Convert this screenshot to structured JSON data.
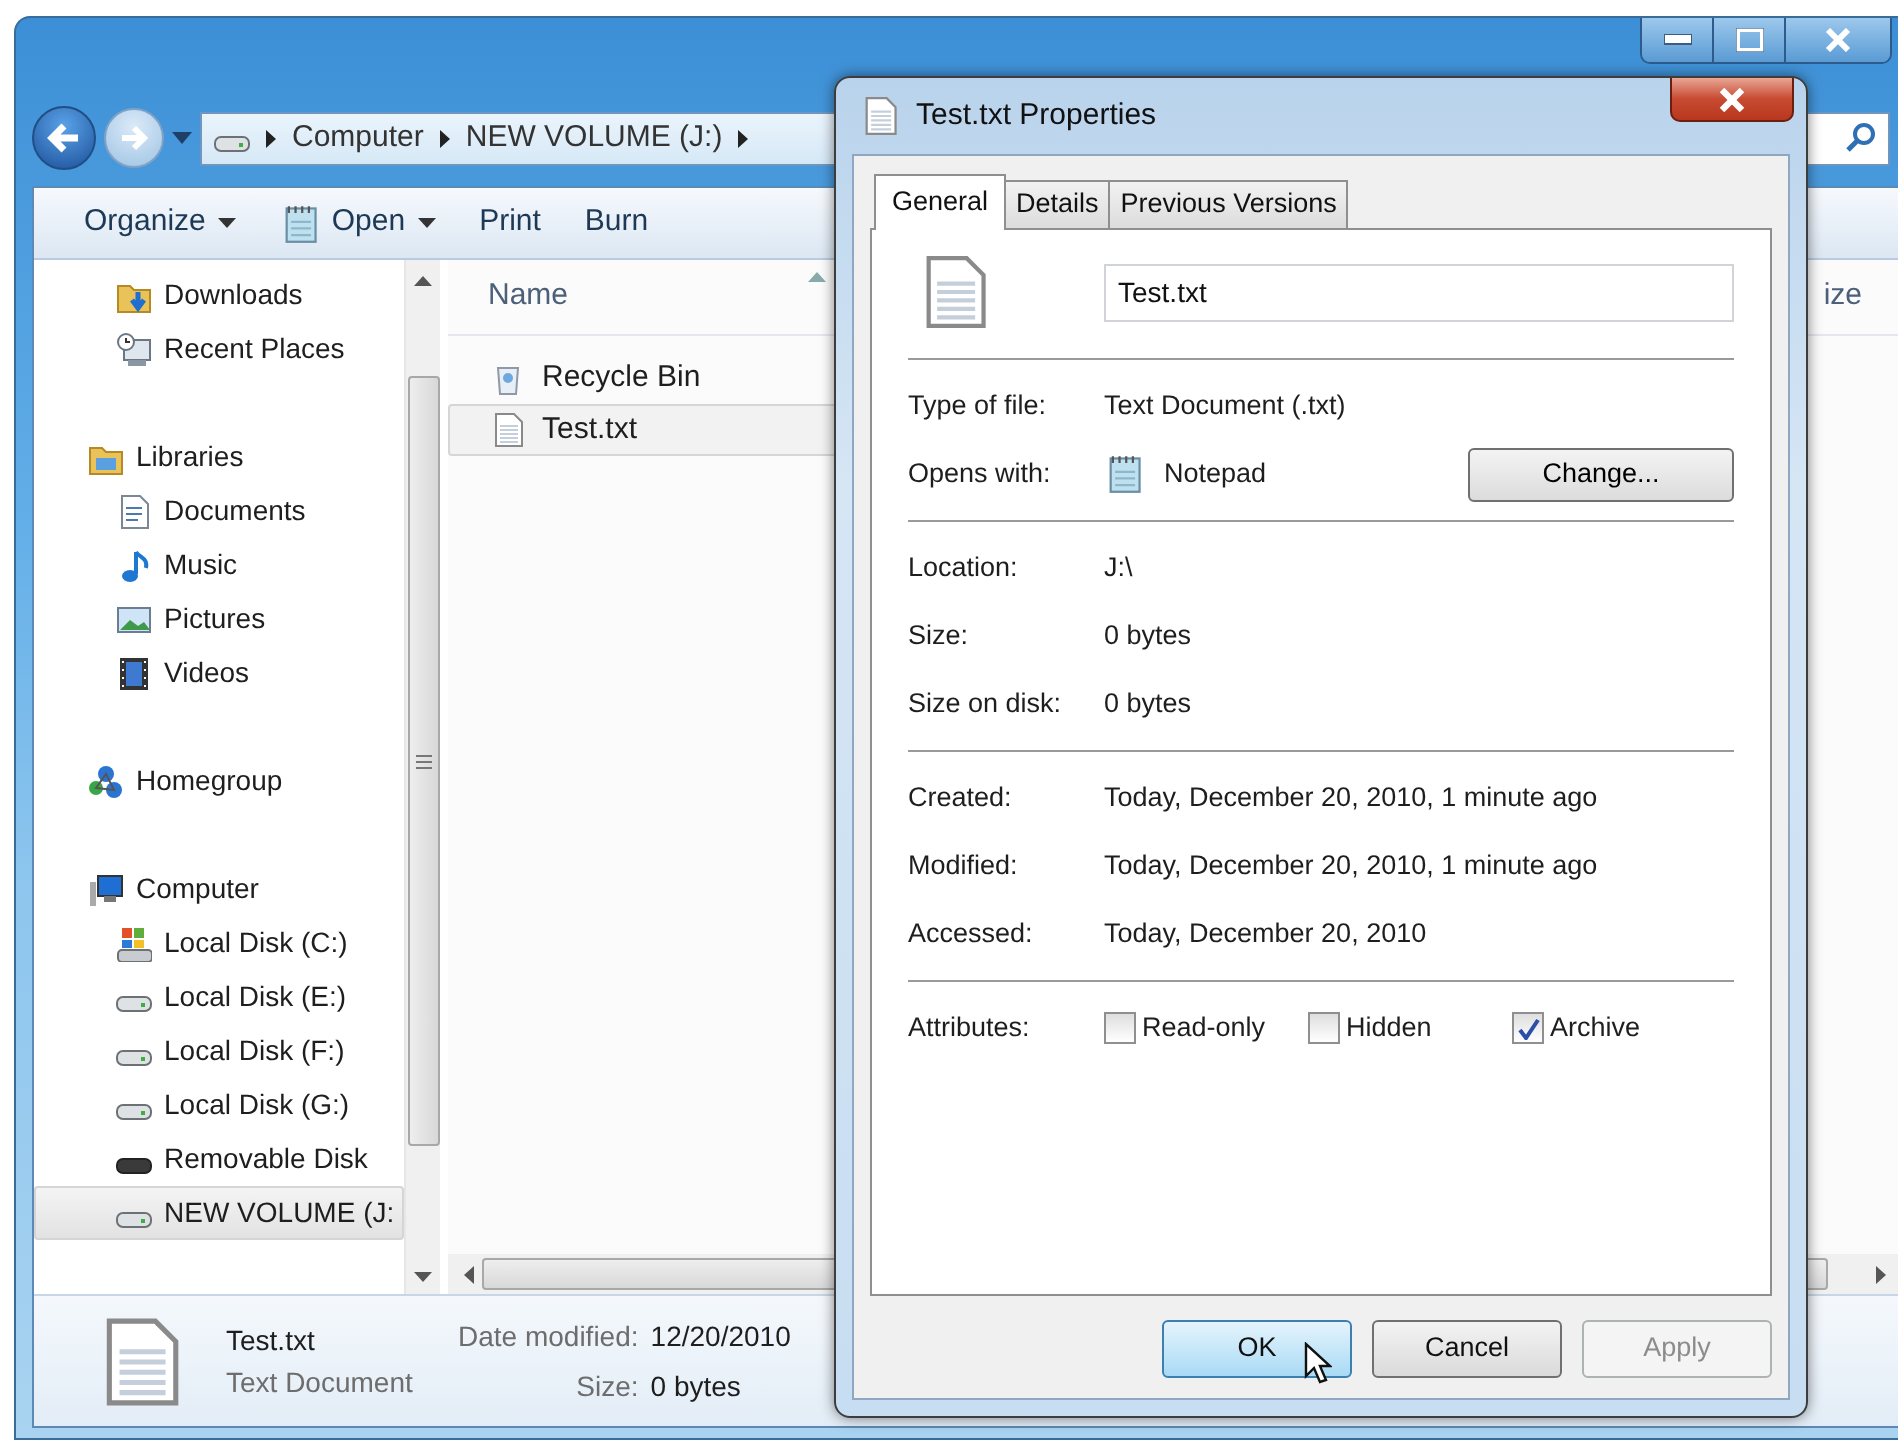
{
  "explorer": {
    "breadcrumb": [
      "Computer",
      "NEW VOLUME (J:)"
    ],
    "toolbar": [
      {
        "label": "Organize",
        "dropdown": true
      },
      {
        "label": "Open",
        "dropdown": true,
        "kind": "notepad"
      },
      {
        "label": "Print",
        "dropdown": false
      },
      {
        "label": "Burn",
        "dropdown": false
      }
    ],
    "nav": [
      {
        "children": [
          {
            "label": "Downloads",
            "kind": "downloads",
            "selected": false
          },
          {
            "label": "Recent Places",
            "kind": "recent",
            "selected": false
          }
        ]
      },
      {
        "label": "Libraries",
        "kind": "libraries",
        "selected": false,
        "children": [
          {
            "label": "Documents",
            "kind": "documents",
            "selected": false
          },
          {
            "label": "Music",
            "kind": "music",
            "selected": false
          },
          {
            "label": "Pictures",
            "kind": "pictures",
            "selected": false
          },
          {
            "label": "Videos",
            "kind": "videos",
            "selected": false
          }
        ]
      },
      {
        "label": "Homegroup",
        "kind": "homegroup",
        "selected": false
      },
      {
        "label": "Computer",
        "kind": "computer",
        "selected": false,
        "children": [
          {
            "label": "Local Disk (C:)",
            "kind": "system-disk",
            "selected": false
          },
          {
            "label": "Local Disk (E:)",
            "kind": "disk",
            "selected": false
          },
          {
            "label": "Local Disk (F:)",
            "kind": "disk",
            "selected": false
          },
          {
            "label": "Local Disk (G:)",
            "kind": "disk",
            "selected": false
          },
          {
            "label": "Removable Disk",
            "kind": "removable",
            "selected": false
          },
          {
            "label": "NEW VOLUME (J:",
            "kind": "disk",
            "selected": true
          }
        ]
      }
    ],
    "columns": [
      "Name",
      "ize"
    ],
    "files": [
      {
        "name": "Recycle Bin",
        "kind": "recycle",
        "selected": false
      },
      {
        "name": "Test.txt",
        "kind": "text",
        "selected": true
      }
    ],
    "details": {
      "name": "Test.txt",
      "type": "Text Document",
      "fields": [
        {
          "label": "Date modified:",
          "value": "12/20/2010"
        },
        {
          "label": "Size:",
          "value": "0 bytes"
        }
      ]
    }
  },
  "dialog": {
    "title": "Test.txt Properties",
    "tabs": [
      {
        "label": "General",
        "selected": true
      },
      {
        "label": "Details",
        "selected": false
      },
      {
        "label": "Previous Versions",
        "selected": false
      }
    ],
    "file_name": "Test.txt",
    "sections": [
      [
        {
          "label": "Type of file:",
          "value": "Text Document (.txt)"
        },
        {
          "label": "Opens with:",
          "value": "Notepad",
          "kind": "app",
          "button": "Change..."
        }
      ],
      [
        {
          "label": "Location:",
          "value": "J:\\"
        },
        {
          "label": "Size:",
          "value": "0 bytes"
        },
        {
          "label": "Size on disk:",
          "value": "0 bytes"
        }
      ],
      [
        {
          "label": "Created:",
          "value": "Today, December 20, 2010, 1 minute ago"
        },
        {
          "label": "Modified:",
          "value": "Today, December 20, 2010, 1 minute ago"
        },
        {
          "label": "Accessed:",
          "value": "Today, December 20, 2010"
        }
      ]
    ],
    "attributes": {
      "label": "Attributes:",
      "options": [
        {
          "label": "Read-only",
          "checked": false
        },
        {
          "label": "Hidden",
          "checked": false
        },
        {
          "label": "Archive",
          "checked": true
        }
      ]
    },
    "buttons": [
      {
        "label": "OK",
        "focused": true,
        "disabled": false
      },
      {
        "label": "Cancel",
        "focused": false,
        "disabled": false
      },
      {
        "label": "Apply",
        "focused": false,
        "disabled": true
      }
    ]
  }
}
